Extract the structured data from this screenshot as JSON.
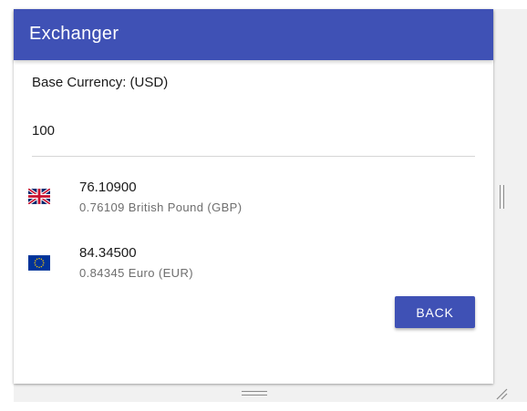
{
  "app": {
    "title": "Exchanger"
  },
  "base": {
    "label": "Base Currency: (USD)",
    "amount": "100"
  },
  "rates": [
    {
      "flag": "uk-flag-icon",
      "converted": "76.10900",
      "detail": "0.76109 British Pound (GBP)"
    },
    {
      "flag": "eu-flag-icon",
      "converted": "84.34500",
      "detail": "0.84345 Euro (EUR)"
    }
  ],
  "actions": {
    "back_label": "BACK"
  },
  "colors": {
    "primary": "#3f51b5",
    "text": "#1a1a1a",
    "secondary_text": "#6e6e6e"
  }
}
